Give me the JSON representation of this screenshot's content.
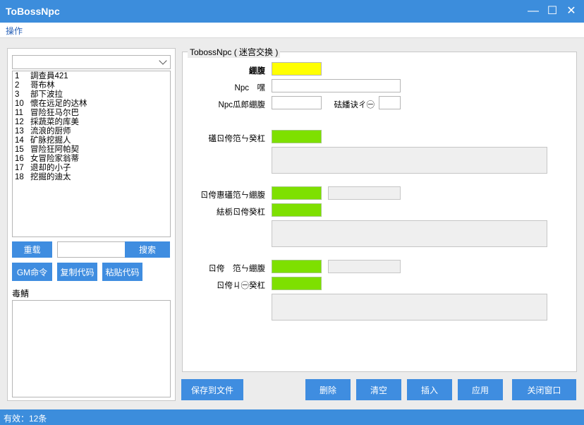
{
  "window": {
    "title": "ToBossNpc",
    "controls": [
      "—",
      "☐",
      "✕"
    ]
  },
  "menu": {
    "items": [
      "操作"
    ]
  },
  "left": {
    "combo_value": "",
    "npc_list": [
      {
        "num": "1",
        "name": "調查員421"
      },
      {
        "num": "2",
        "name": "哥布林"
      },
      {
        "num": "3",
        "name": "部下波拉"
      },
      {
        "num": "10",
        "name": "懷在远足的达林"
      },
      {
        "num": "11",
        "name": "冒险狂马尔巴"
      },
      {
        "num": "12",
        "name": "採蔬菜的库美"
      },
      {
        "num": "13",
        "name": "流浪的厨师"
      },
      {
        "num": "14",
        "name": "矿脉挖掘人"
      },
      {
        "num": "15",
        "name": "冒险狂阿帕契"
      },
      {
        "num": "16",
        "name": "女冒险家翁蒂"
      },
      {
        "num": "17",
        "name": "退却的小子"
      },
      {
        "num": "18",
        "name": "挖掘的迪太"
      }
    ],
    "reload_btn": "重载",
    "search_value": "",
    "search_btn": "搜索",
    "gm_btn": "GM命令",
    "copy_btn": "复制代码",
    "paste_btn": "粘贴代码",
    "log_label": "毒鯖",
    "log_value": ""
  },
  "group": {
    "title": "TobossNpc ( 迷宫交换 )",
    "fields": {
      "f1_label": "綳腹",
      "f1_color": "#ffff00",
      "f2_label": "Npc　嘿",
      "f2_value": "",
      "f3_label": "Npc瓜郎綳腹",
      "f3_value": "",
      "f4_label": "砝繙诀ㄔ㊀",
      "f4_value": "",
      "f5_label": "礚ㄖ侉笵ㄣ癸杠",
      "f5_color": "#7ee000",
      "f5_text": "",
      "f6_label": "ㄖ侉惠礚笵ㄣ綳腹",
      "f6_color": "#7ee000",
      "f6_value": "",
      "f7_label": "紶栃ㄖ侉癸杠",
      "f7_color": "#7ee000",
      "f7_text": "",
      "f8_label": "ㄖ侉　笵ㄣ綳腹",
      "f8_color": "#7ee000",
      "f8_value": "",
      "f9_label": "ㄖ侉ㄐ㊀癸杠",
      "f9_color": "#7ee000",
      "f9_text": ""
    }
  },
  "actions": {
    "save_btn": "保存到文件",
    "delete_btn": "删除",
    "clear_btn": "清空",
    "insert_btn": "插入",
    "apply_btn": "应用",
    "close_btn": "关闭窗口"
  },
  "status": {
    "text": "有效：12条"
  },
  "colors": {
    "accent": "#3c8ddc",
    "button": "#3f8de0",
    "status": "#3c8ddc"
  }
}
